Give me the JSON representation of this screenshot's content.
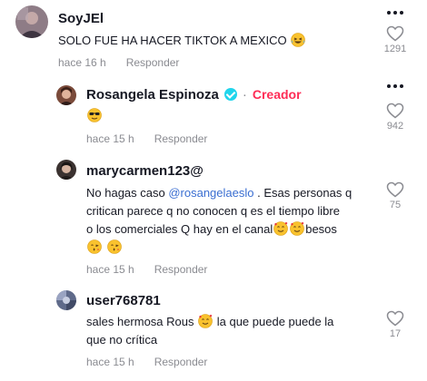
{
  "comments": [
    {
      "username": "SoyJEl",
      "text": "SOLO FUE HA HACER TIKTOK A MEXICO",
      "time": "hace 16 h",
      "reply_label": "Responder",
      "likes": "1291",
      "emoji": "laughing-tears"
    },
    {
      "username": "Rosangela Espinoza",
      "badge_label": "Creador",
      "text": "",
      "time": "hace 15 h",
      "reply_label": "Responder",
      "likes": "942",
      "emoji": "sunglasses"
    },
    {
      "username": "marycarmen123@",
      "text_pre": "No hagas caso ",
      "mention": "@rosangelaeslo",
      "text_line1_post": " . Esas personas q",
      "text_line2": "critican parece q no conocen q es el tiempo libre",
      "text_line3_pre": "o los comerciales Q hay en el canal",
      "text_line3_post": "besos",
      "time": "hace 15 h",
      "reply_label": "Responder",
      "likes": "75"
    },
    {
      "username": "user768781",
      "text_line1_pre": "sales hermosa Rous ",
      "text_line1_post": " la que puede puede la",
      "text_line2": "que no crítica",
      "time": "hace 15 h",
      "reply_label": "Responder",
      "likes": "17"
    }
  ]
}
